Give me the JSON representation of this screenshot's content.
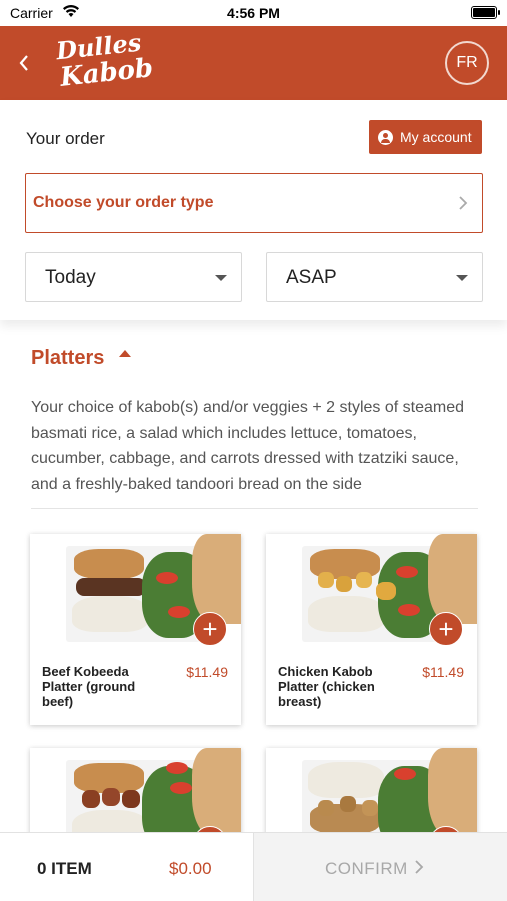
{
  "status_bar": {
    "carrier": "Carrier",
    "time": "4:56 PM"
  },
  "header": {
    "back_icon": "chevron-left-icon",
    "brand_line1": "Dulles",
    "brand_line2": "Kabob",
    "avatar_initials": "FR"
  },
  "order": {
    "title": "Your order",
    "account_label": "My account",
    "order_type_label": "Choose your order type",
    "day_value": "Today",
    "time_value": "ASAP"
  },
  "category": {
    "name": "Platters",
    "description": "Your choice of kabob(s) and/or veggies + 2 styles of steamed basmati rice, a salad which includes lettuce, tomatoes, cucumber, cabbage, and carrots dressed with tzatziki sauce, and a freshly-baked tandoori bread on the side"
  },
  "products": [
    {
      "name": "Beef Kobeeda Platter (ground beef)",
      "price": "$11.49"
    },
    {
      "name": "Chicken Kabob Platter (chicken breast)",
      "price": "$11.49"
    },
    {
      "name": "",
      "price": ""
    },
    {
      "name": "",
      "price": ""
    }
  ],
  "cart": {
    "items_label": "0 ITEM",
    "total": "$0.00",
    "confirm_label": "CONFIRM"
  },
  "colors": {
    "brand": "#c14b2a",
    "muted": "#a8a8a8"
  }
}
